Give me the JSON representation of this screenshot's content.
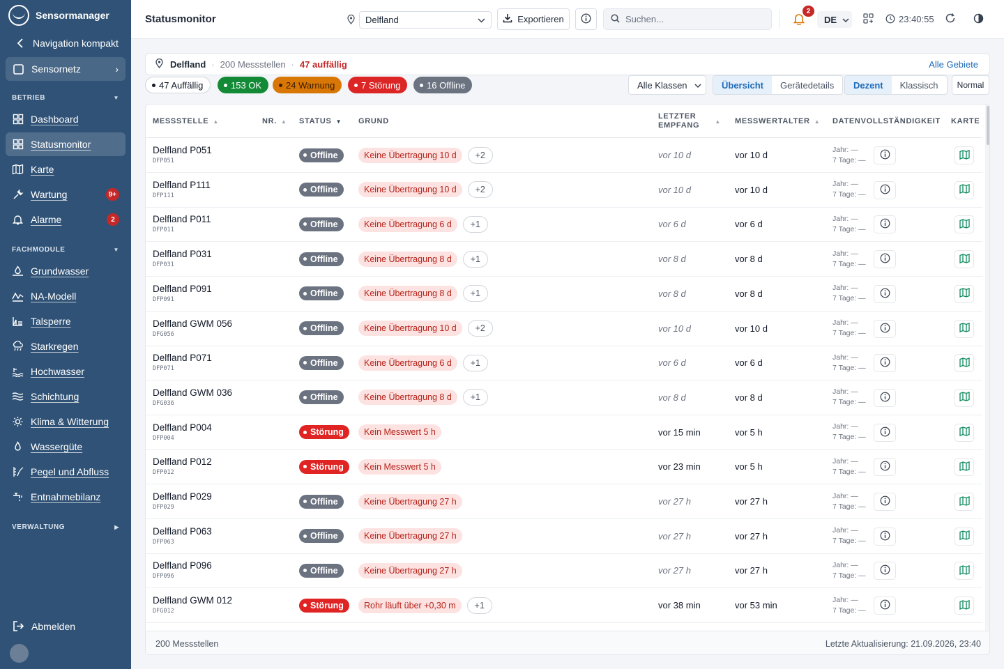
{
  "app": {
    "name": "Sensormanager"
  },
  "sidebar": {
    "nav_compact": "Navigation kompakt",
    "sensornetz": "Sensornetz",
    "sections": {
      "betrieb": "BETRIEB",
      "fachmodule": "FACHMODULE",
      "verwaltung": "VERWALTUNG"
    },
    "betrieb_items": [
      {
        "label": "Dashboard",
        "icon": "dashboard-icon"
      },
      {
        "label": "Statusmonitor",
        "icon": "dashboard-icon",
        "active": true
      },
      {
        "label": "Karte",
        "icon": "map-icon"
      },
      {
        "label": "Wartung",
        "icon": "wrench-icon",
        "badge": "9+"
      },
      {
        "label": "Alarme",
        "icon": "bell-icon",
        "badge": "2"
      }
    ],
    "fachmodule_items": [
      {
        "label": "Grundwasser",
        "icon": "groundwater-icon"
      },
      {
        "label": "NA-Modell",
        "icon": "graph-icon"
      },
      {
        "label": "Talsperre",
        "icon": "dam-icon"
      },
      {
        "label": "Starkregen",
        "icon": "rain-icon"
      },
      {
        "label": "Hochwasser",
        "icon": "flood-icon"
      },
      {
        "label": "Schichtung",
        "icon": "layers-icon"
      },
      {
        "label": "Klima & Witterung",
        "icon": "sun-icon"
      },
      {
        "label": "Wassergüte",
        "icon": "drop-icon"
      },
      {
        "label": "Pegel und Abfluss",
        "icon": "gauge-icon"
      },
      {
        "label": "Entnahmebilanz",
        "icon": "tap-icon"
      }
    ],
    "logout": "Abmelden"
  },
  "header": {
    "title": "Statusmonitor",
    "region": "Delfland",
    "export_label": "Exportieren",
    "search_placeholder": "Suchen...",
    "notifications": "2",
    "language": "DE",
    "clock": "23:40:55"
  },
  "summary": {
    "region": "Delfland",
    "stations": "200 Messstellen",
    "abnormal": "47 auffällig",
    "all_areas": "Alle Gebiete"
  },
  "filters": {
    "all": "47 Auffällig",
    "ok": "153 OK",
    "warn": "24 Warnung",
    "err": "7 Störung",
    "off": "16 Offline",
    "class_select": "Alle Klassen",
    "view_tabs": [
      "Übersicht",
      "Gerätedetails"
    ],
    "style_tabs": [
      "Dezent",
      "Klassisch"
    ],
    "density": "Normal"
  },
  "colors": {
    "sidebar": "#2f5276",
    "ok": "#138a36",
    "warning": "#d97706",
    "error": "#dc2626",
    "offline": "#6b7280",
    "accent": "#1e6bb8"
  },
  "table": {
    "columns": {
      "station": "MESSSTELLE",
      "nr": "NR.",
      "status": "STATUS",
      "reason": "GRUND",
      "last_rx": "LETZTER EMPFANG",
      "age": "MESSWERTALTER",
      "completeness": "DATENVOLLSTÄNDIGKEIT",
      "map": "KARTE"
    },
    "rows": [
      {
        "name": "Delfland P051",
        "code": "DFP051",
        "status": "Offline",
        "reason": "Keine Übertragung 10 d",
        "more": "+2",
        "last": "vor 10 d",
        "age": "vor 10 d",
        "year": "Jahr: —",
        "week": "7 Tage: —"
      },
      {
        "name": "Delfland P111",
        "code": "DFP111",
        "status": "Offline",
        "reason": "Keine Übertragung 10 d",
        "more": "+2",
        "last": "vor 10 d",
        "age": "vor 10 d",
        "year": "Jahr: —",
        "week": "7 Tage: —"
      },
      {
        "name": "Delfland P011",
        "code": "DFP011",
        "status": "Offline",
        "reason": "Keine Übertragung 6 d",
        "more": "+1",
        "last": "vor 6 d",
        "age": "vor 6 d",
        "year": "Jahr: —",
        "week": "7 Tage: —"
      },
      {
        "name": "Delfland P031",
        "code": "DFP031",
        "status": "Offline",
        "reason": "Keine Übertragung 8 d",
        "more": "+1",
        "last": "vor 8 d",
        "age": "vor 8 d",
        "year": "Jahr: —",
        "week": "7 Tage: —"
      },
      {
        "name": "Delfland P091",
        "code": "DFP091",
        "status": "Offline",
        "reason": "Keine Übertragung 8 d",
        "more": "+1",
        "last": "vor 8 d",
        "age": "vor 8 d",
        "year": "Jahr: —",
        "week": "7 Tage: —"
      },
      {
        "name": "Delfland GWM 056",
        "code": "DFG056",
        "status": "Offline",
        "reason": "Keine Übertragung 10 d",
        "more": "+2",
        "last": "vor 10 d",
        "age": "vor 10 d",
        "year": "Jahr: —",
        "week": "7 Tage: —"
      },
      {
        "name": "Delfland P071",
        "code": "DFP071",
        "status": "Offline",
        "reason": "Keine Übertragung 6 d",
        "more": "+1",
        "last": "vor 6 d",
        "age": "vor 6 d",
        "year": "Jahr: —",
        "week": "7 Tage: —"
      },
      {
        "name": "Delfland GWM 036",
        "code": "DFG036",
        "status": "Offline",
        "reason": "Keine Übertragung 8 d",
        "more": "+1",
        "last": "vor 8 d",
        "age": "vor 8 d",
        "year": "Jahr: —",
        "week": "7 Tage: —"
      },
      {
        "name": "Delfland P004",
        "code": "DFP004",
        "status": "Störung",
        "reason": "Kein Messwert 5 h",
        "more": "",
        "last": "vor 15 min",
        "age": "vor 5 h",
        "year": "Jahr: —",
        "week": "7 Tage: —"
      },
      {
        "name": "Delfland P012",
        "code": "DFP012",
        "status": "Störung",
        "reason": "Kein Messwert 5 h",
        "more": "",
        "last": "vor 23 min",
        "age": "vor 5 h",
        "year": "Jahr: —",
        "week": "7 Tage: —"
      },
      {
        "name": "Delfland P029",
        "code": "DFP029",
        "status": "Offline",
        "reason": "Keine Übertragung 27 h",
        "more": "",
        "last": "vor 27 h",
        "age": "vor 27 h",
        "year": "Jahr: —",
        "week": "7 Tage: —"
      },
      {
        "name": "Delfland P063",
        "code": "DFP063",
        "status": "Offline",
        "reason": "Keine Übertragung 27 h",
        "more": "",
        "last": "vor 27 h",
        "age": "vor 27 h",
        "year": "Jahr: —",
        "week": "7 Tage: —"
      },
      {
        "name": "Delfland P096",
        "code": "DFP096",
        "status": "Offline",
        "reason": "Keine Übertragung 27 h",
        "more": "",
        "last": "vor 27 h",
        "age": "vor 27 h",
        "year": "Jahr: —",
        "week": "7 Tage: —"
      },
      {
        "name": "Delfland GWM 012",
        "code": "DFG012",
        "status": "Störung",
        "reason": "Rohr läuft über +0,30 m",
        "more": "+1",
        "last": "vor 38 min",
        "age": "vor 53 min",
        "year": "Jahr: —",
        "week": "7 Tage: —"
      }
    ],
    "footer_count": "200 Messstellen",
    "footer_updated": "Letzte Aktualisierung: 21.09.2026, 23:40"
  }
}
